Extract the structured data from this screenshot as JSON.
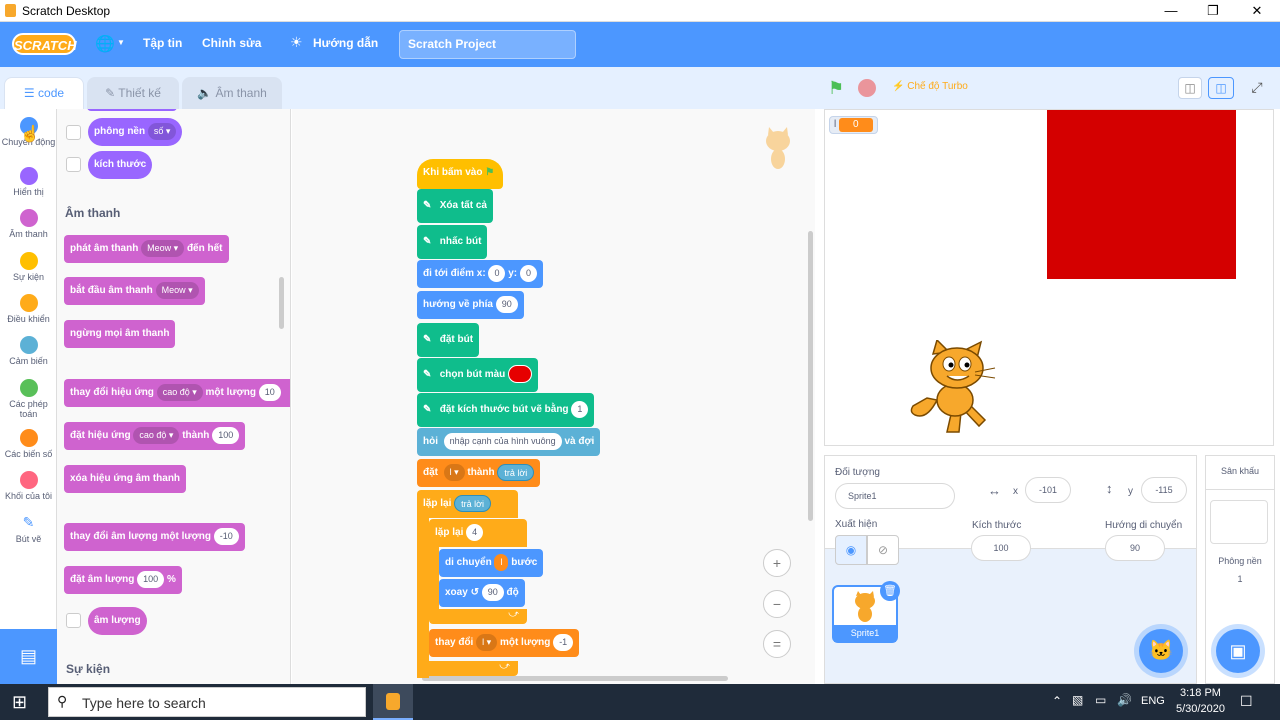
{
  "window": {
    "title": "Scratch Desktop"
  },
  "menu": {
    "logo": "SCRATCH",
    "file": "Tập tin",
    "edit": "Chỉnh sửa",
    "tutorials": "Hướng dẫn",
    "project_name": "Scratch Project"
  },
  "tabs": {
    "code": "code",
    "costumes": "Thiết kế",
    "sounds": "Âm thanh"
  },
  "categories": [
    {
      "label": "Chuyển động",
      "color": "#4c97ff"
    },
    {
      "label": "Hiển thị",
      "color": "#9966ff"
    },
    {
      "label": "Âm thanh",
      "color": "#cf63cf"
    },
    {
      "label": "Sự kiện",
      "color": "#ffbf00"
    },
    {
      "label": "Điều khiển",
      "color": "#ffab19"
    },
    {
      "label": "Cảm biến",
      "color": "#5cb1d6"
    },
    {
      "label": "Các phép toán",
      "color": "#59c059"
    },
    {
      "label": "Các biến số",
      "color": "#ff8c1a"
    },
    {
      "label": "Khối của tôi",
      "color": "#ff6680"
    },
    {
      "label": "Bút vẽ",
      "color": "#0fbd8c"
    }
  ],
  "palette": {
    "backdrop_block": "phông nền",
    "backdrop_opt": "số",
    "size_block": "kích thước",
    "sound_header": "Âm thanh",
    "play_until": "phát âm thanh",
    "play_opt": "Meow",
    "play_end": "đến hết",
    "start_sound": "bắt đầu âm thanh",
    "start_opt": "Meow",
    "stop_all": "ngừng mọi âm thanh",
    "change_effect": "thay đổi hiệu ứng",
    "change_effect_opt": "cao độ",
    "change_effect_by": "một lượng",
    "change_effect_val": "10",
    "set_effect": "đặt hiệu ứng",
    "set_effect_opt": "cao độ",
    "set_effect_to": "thành",
    "set_effect_val": "100",
    "clear_effects": "xóa hiệu ứng âm thanh",
    "change_volume": "thay đổi âm lượng một lượng",
    "change_volume_val": "-10",
    "set_volume": "đặt âm lượng",
    "set_volume_val": "100",
    "set_volume_pct": "%",
    "volume": "âm lượng",
    "events_header": "Sự kiện"
  },
  "script": {
    "hat": "Khi bấm vào",
    "clear": "Xóa tất cả",
    "pen_up": "nhấc bút",
    "goto": "đi tới điểm x:",
    "goto_x": "0",
    "goto_y_lbl": "y:",
    "goto_y": "0",
    "point": "hướng về phía",
    "point_val": "90",
    "pen_down": "đặt bút",
    "pen_color": "chọn bút màu",
    "pen_size": "đặt kích thước bút vẽ bằng",
    "pen_size_val": "1",
    "ask": "hỏi",
    "ask_val": "nhập cạnh của hình vuông",
    "ask_wait": "và đợi",
    "set": "đặt",
    "set_var": "l",
    "set_to": "thành",
    "answer": "trả lời",
    "repeat1": "lặp lại",
    "repeat1_val": "trả lời",
    "repeat2": "lặp lại",
    "repeat2_val": "4",
    "move": "di chuyển",
    "move_val": "l",
    "move_steps": "bước",
    "turn": "xoay",
    "turn_val": "90",
    "turn_deg": "độ",
    "change": "thay đổi",
    "change_var": "l",
    "change_by": "một lượng",
    "change_val": "-1"
  },
  "stage": {
    "turbo": "Chế độ Turbo",
    "var_name": "l",
    "var_value": "0"
  },
  "sprite": {
    "label": "Đối tượng",
    "name": "Sprite1",
    "x_label": "x",
    "x": "-101",
    "y_label": "y",
    "y": "-115",
    "show_label": "Xuất hiện",
    "size_label": "Kích thước",
    "size": "100",
    "dir_label": "Hướng di chuyển",
    "dir": "90",
    "thumb_name": "Sprite1"
  },
  "stage_panel": {
    "title": "Sân khấu",
    "backdrops_label": "Phông nền",
    "backdrops_count": "1"
  },
  "taskbar": {
    "search": "Type here to search",
    "lang": "ENG",
    "time": "3:18 PM",
    "date": "5/30/2020"
  },
  "colors": {
    "motion": "#4c97ff",
    "looks": "#9966ff",
    "sound": "#cf63cf",
    "events": "#ffbf00",
    "control": "#ffab19",
    "pen": "#0fbd8c",
    "sensing": "#5cb1d6",
    "variables": "#ff8c1a",
    "pen_color_value": "#e60000"
  }
}
